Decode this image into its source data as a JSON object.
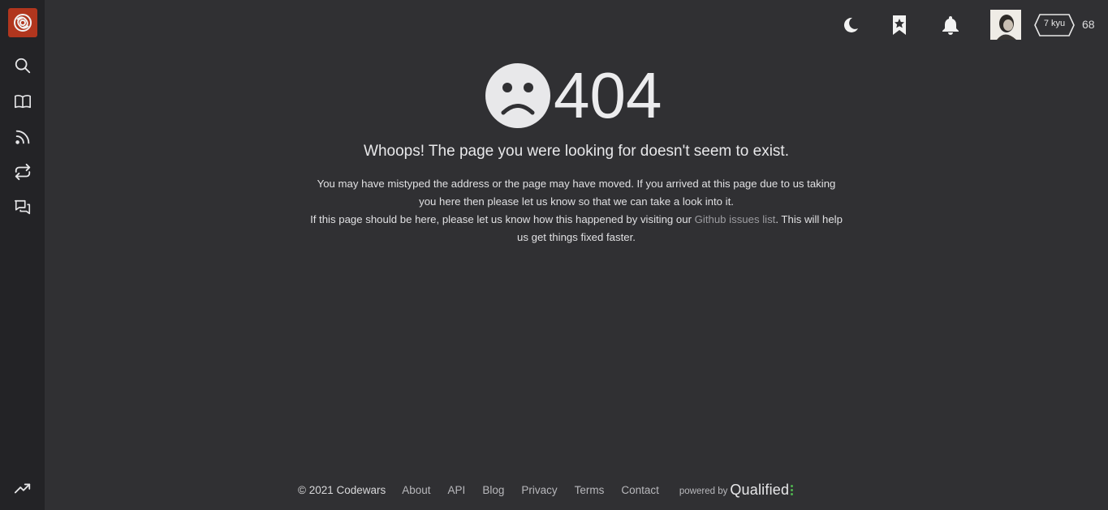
{
  "sidebar": {
    "logo": "codewars-logo-icon",
    "items": [
      {
        "icon": "search-icon",
        "label": "Search"
      },
      {
        "icon": "book-icon",
        "label": "Docs"
      },
      {
        "icon": "rss-icon",
        "label": "Feed"
      },
      {
        "icon": "repeat-icon",
        "label": "Practice"
      },
      {
        "icon": "chat-icon",
        "label": "Discussions"
      }
    ],
    "bottom_item": {
      "icon": "trending-up-icon",
      "label": "Leaderboards"
    }
  },
  "topbar": {
    "theme_icon": "moon-icon",
    "bookmark_icon": "bookmark-star-icon",
    "notification_icon": "bell-icon",
    "rank": "7 kyu",
    "honor": "68"
  },
  "error": {
    "code": "404",
    "headline": "Whoops! The page you were looking for doesn't seem to exist.",
    "line1": "You may have mistyped the address or the page may have moved. If you arrived at this page due to us taking you here then please let us know so that we can take a look into it.",
    "line2_before": "If this page should be here, please let us know how this happened by visiting our ",
    "line2_link": "Github issues list",
    "line2_after": ". This will help us get things fixed faster."
  },
  "footer": {
    "copyright": "© 2021 Codewars",
    "links": [
      "About",
      "API",
      "Blog",
      "Privacy",
      "Terms",
      "Contact"
    ],
    "powered_by": "powered by",
    "brand": "Qualified"
  },
  "colors": {
    "background": "#303033",
    "sidebar": "#232326",
    "logo": "#b1361e",
    "accent_green": "#4fb34f"
  }
}
